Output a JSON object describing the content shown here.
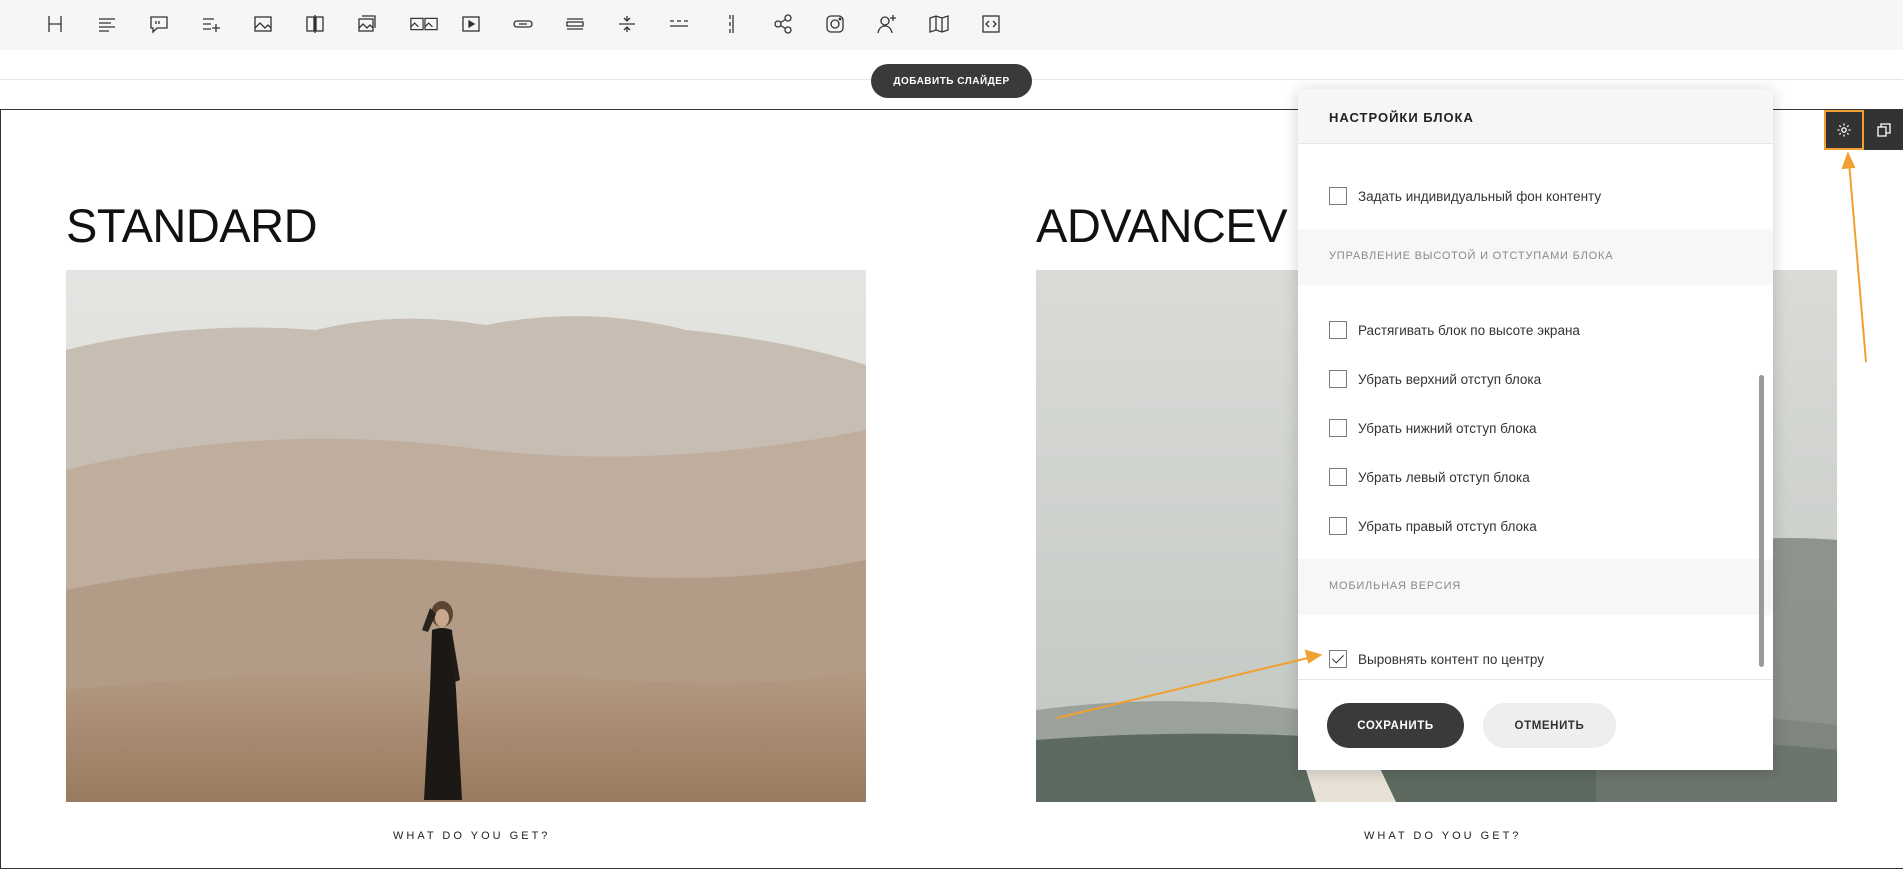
{
  "toolbar": {
    "icons": [
      "heading-icon",
      "text-align-icon",
      "quote-icon",
      "list-add-icon",
      "image-icon",
      "image-compare-icon",
      "image-stack-icon",
      "gallery-icon",
      "video-icon",
      "button-icon",
      "spacer-icon",
      "divider-icon",
      "dashed-divider-icon",
      "vertical-divider-icon",
      "share-icon",
      "instagram-icon",
      "user-add-icon",
      "map-icon",
      "code-icon"
    ]
  },
  "add_slider_button": "ДОБАВИТЬ СЛАЙДЕР",
  "content": {
    "left_title": "STANDARD",
    "right_title": "ADVANCEV",
    "left_caption": "WHAT DO YOU GET?",
    "right_caption": "WHAT DO YOU GET?"
  },
  "panel": {
    "title": "НАСТРОЙКИ БЛОКА",
    "top_checkbox_label": "Задать индивидуальный фон контенту",
    "section_height_label": "УПРАВЛЕНИЕ ВЫСОТОЙ И ОТСТУПАМИ БЛОКА",
    "height_options": [
      {
        "label": "Растягивать блок по высоте экрана",
        "checked": false
      },
      {
        "label": "Убрать верхний отступ блока",
        "checked": false
      },
      {
        "label": "Убрать нижний отступ блока",
        "checked": false
      },
      {
        "label": "Убрать левый отступ блока",
        "checked": false
      },
      {
        "label": "Убрать правый отступ блока",
        "checked": false
      }
    ],
    "section_mobile_label": "МОБИЛЬНАЯ ВЕРСИЯ",
    "mobile_option": {
      "label": "Выровнять контент по центру",
      "checked": true
    },
    "save_label": "СОХРАНИТЬ",
    "cancel_label": "ОТМЕНИТЬ"
  },
  "colors": {
    "accent": "#f0a030",
    "dark": "#3a3a3a",
    "toolbar_bg": "#f6f6f6"
  }
}
